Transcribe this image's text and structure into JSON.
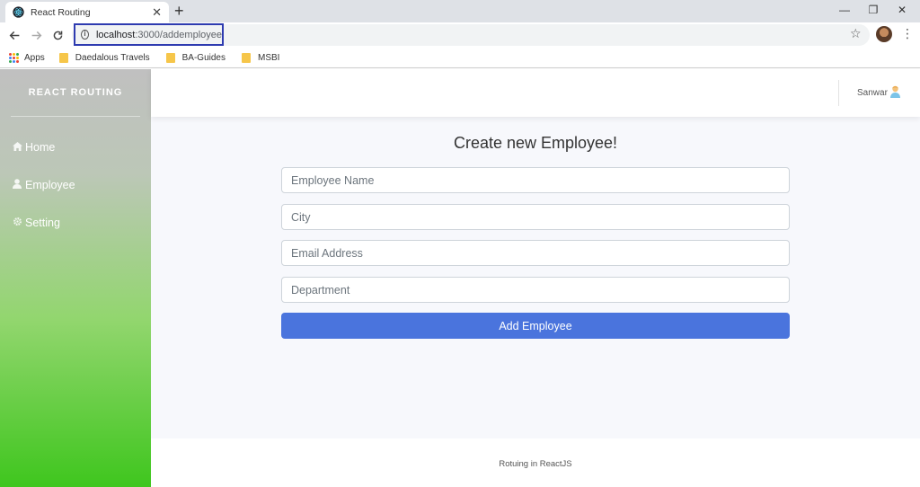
{
  "browser": {
    "tab_title": "React Routing",
    "tab_close": "✕",
    "new_tab": "+",
    "window_controls": {
      "minimize": "—",
      "restore": "❐",
      "close": "✕"
    },
    "url_host": "localhost",
    "url_rest": ":3000/addemployee",
    "bookmarks": [
      {
        "label": "Apps",
        "icon": "apps-grid-icon"
      },
      {
        "label": "Daedalous Travels",
        "icon": "folder-icon"
      },
      {
        "label": "BA-Guides",
        "icon": "folder-icon"
      },
      {
        "label": "MSBI",
        "icon": "folder-icon"
      }
    ]
  },
  "sidebar": {
    "brand": "REACT ROUTING",
    "items": [
      {
        "label": "Home",
        "icon": "home-icon"
      },
      {
        "label": "Employee",
        "icon": "user-icon"
      },
      {
        "label": "Setting",
        "icon": "gear-icon"
      }
    ]
  },
  "header": {
    "username": "Sanwar"
  },
  "form": {
    "title": "Create new Employee!",
    "fields": [
      {
        "placeholder": "Employee Name",
        "value": ""
      },
      {
        "placeholder": "City",
        "value": ""
      },
      {
        "placeholder": "Email Address",
        "value": ""
      },
      {
        "placeholder": "Department",
        "value": ""
      }
    ],
    "submit_label": "Add Employee"
  },
  "footer": {
    "text": "Rotuing in ReactJS"
  },
  "colors": {
    "accent": "#4a74dd",
    "sidebar_top": "#c0c0c0",
    "sidebar_bottom": "#3fc61e"
  }
}
